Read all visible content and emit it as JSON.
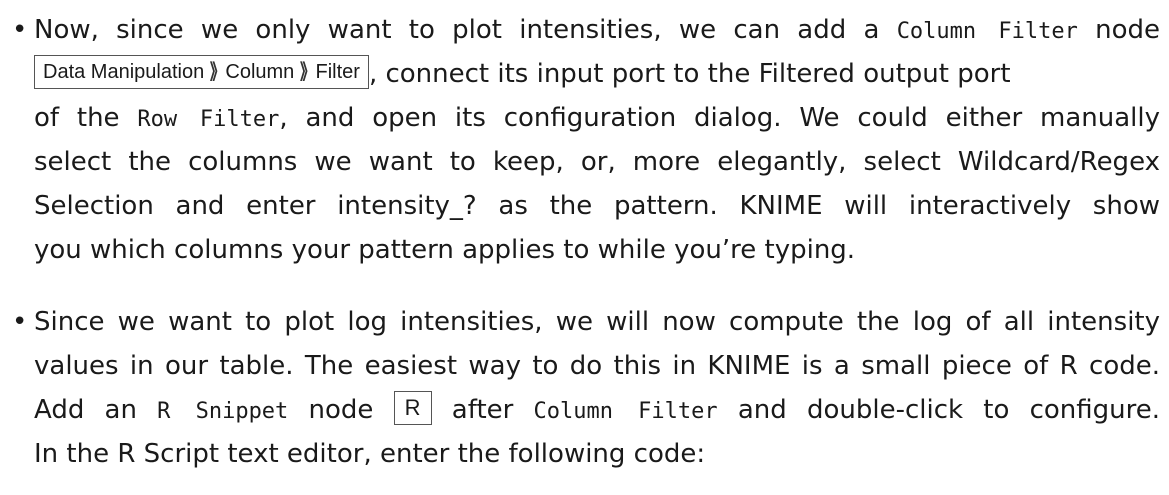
{
  "bullet1": {
    "marker": "•",
    "l1_a": "Now, since we only want to plot intensities, we can add a ",
    "l1_code": "Column Filter",
    "l1_b": " node",
    "menu_path": [
      "Data Manipulation",
      "Column",
      "Filter"
    ],
    "l2_b": ", connect its input port to the Filtered output port",
    "l3_a": "of the ",
    "l3_code": "Row Filter",
    "l3_b": ", and open its configuration dialog. We could either manually",
    "l4": "select the columns we want to keep, or, more elegantly, select Wildcard/Regex",
    "l5": "Selection and enter intensity_? as the pattern.  KNIME will interactively show",
    "l6": "you which columns your pattern applies to while you’re typing."
  },
  "bullet2": {
    "marker": "•",
    "l1": "Since we want to plot log intensities, we will now compute the log of all intensity",
    "l2": "values in our table.  The easiest way to do this in KNIME is a small piece of R code.",
    "l3_a": "Add an ",
    "l3_code1": "R Snippet",
    "l3_b": " node ",
    "r_icon": "R",
    "l3_c": " after ",
    "l3_code2": "Column Filter",
    "l3_d": " and double-click to configure.",
    "l4": "In the R Script text editor, enter the following code:"
  }
}
